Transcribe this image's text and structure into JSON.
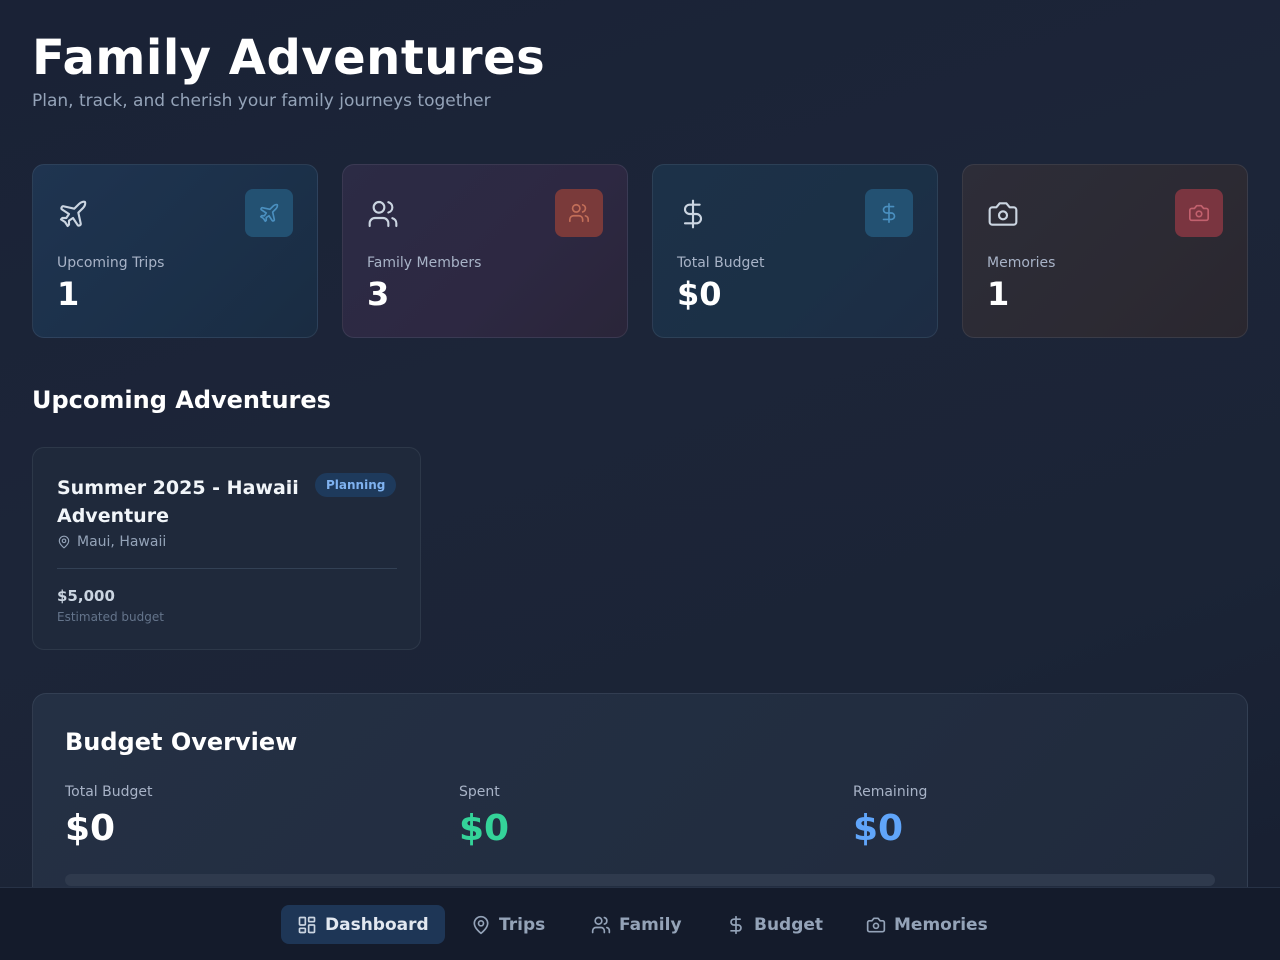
{
  "header": {
    "title": "Family Adventures",
    "subtitle": "Plan, track, and cherish your family journeys together"
  },
  "stats": [
    {
      "label": "Upcoming Trips",
      "value": "1",
      "icon": "plane-icon",
      "accent": "#235172"
    },
    {
      "label": "Family Members",
      "value": "3",
      "icon": "users-icon",
      "accent": "#7a3a3a"
    },
    {
      "label": "Total Budget",
      "value": "$0",
      "icon": "dollar-icon",
      "accent": "#235172"
    },
    {
      "label": "Memories",
      "value": "1",
      "icon": "camera-icon",
      "accent": "#7a3540"
    }
  ],
  "upcoming": {
    "title": "Upcoming Adventures",
    "trips": [
      {
        "name": "Summer 2025 - Hawaii Adventure",
        "status": "Planning",
        "location": "Maui, Hawaii",
        "budget": "$5,000",
        "budget_label": "Estimated budget"
      }
    ]
  },
  "budget_overview": {
    "title": "Budget Overview",
    "total_label": "Total Budget",
    "total_value": "$0",
    "spent_label": "Spent",
    "spent_value": "$0",
    "remaining_label": "Remaining",
    "remaining_value": "$0",
    "spent_fraction": 0,
    "colors": {
      "total": "#ffffff",
      "spent": "#34d399",
      "remaining": "#60a5fa"
    }
  },
  "nav": {
    "items": [
      {
        "label": "Dashboard",
        "icon": "dashboard-icon",
        "active": true
      },
      {
        "label": "Trips",
        "icon": "map-pin-icon",
        "active": false
      },
      {
        "label": "Family",
        "icon": "users-icon",
        "active": false
      },
      {
        "label": "Budget",
        "icon": "dollar-icon",
        "active": false
      },
      {
        "label": "Memories",
        "icon": "camera-icon",
        "active": false
      }
    ]
  }
}
